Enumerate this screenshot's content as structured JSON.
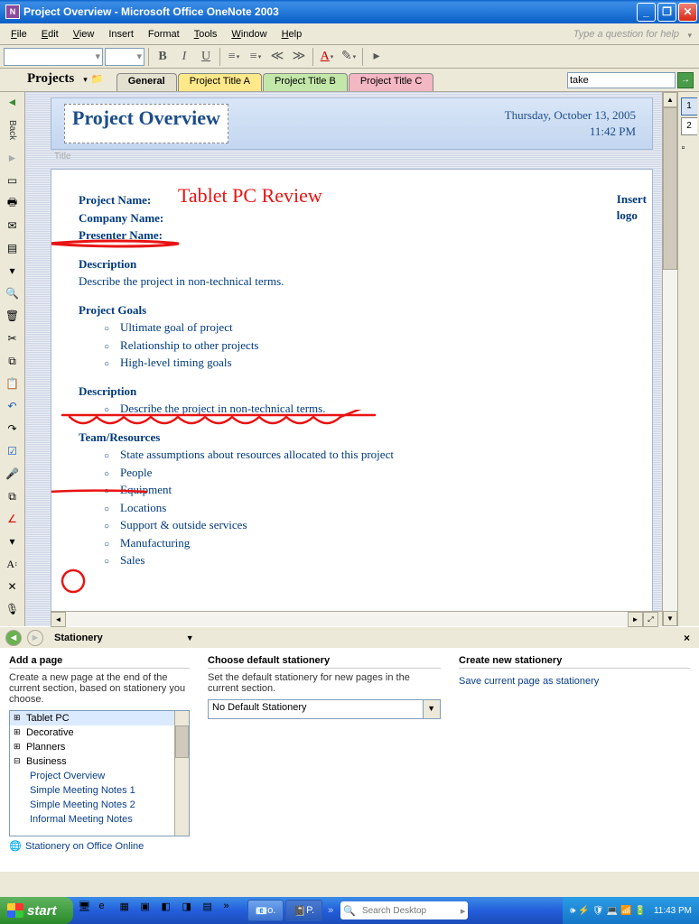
{
  "window": {
    "title": "Project Overview - Microsoft Office OneNote 2003"
  },
  "menu": {
    "file": "File",
    "edit": "Edit",
    "view": "View",
    "insert": "Insert",
    "format": "Format",
    "tools": "Tools",
    "window": "Window",
    "help": "Help",
    "help_placeholder": "Type a question for help"
  },
  "toolbar": {
    "bold": "B",
    "italic": "I",
    "underline": "U"
  },
  "sidebar_back": "Back",
  "section": {
    "name": "Projects"
  },
  "tabs": [
    {
      "label": "General",
      "style": "active"
    },
    {
      "label": "Project Title A",
      "style": "yellow"
    },
    {
      "label": "Project Title B",
      "style": "green"
    },
    {
      "label": "Project Title C",
      "style": "pink"
    }
  ],
  "search": {
    "value": "take"
  },
  "page": {
    "title": "Project Overview",
    "title_placeholder": "Title",
    "date": "Thursday, October 13, 2005",
    "time": "11:42 PM"
  },
  "page_tabs": {
    "p1": "1",
    "p2": "2"
  },
  "content": {
    "project_name_label": "Project Name:",
    "company_name_label": "Company Name:",
    "presenter_name_label": "Presenter Name:",
    "side1": "Insert",
    "side2": "logo",
    "desc_head": "Description",
    "desc_text": "Describe the project in non-technical terms.",
    "goals_head": "Project Goals",
    "goals": [
      "Ultimate goal of project",
      "Relationship to other projects",
      "High-level timing goals"
    ],
    "desc2_head": "Description",
    "desc2_bullet": "Describe the project in non-technical terms.",
    "team_head": "Team/Resources",
    "team": [
      "State assumptions about resources allocated to this project",
      "People",
      "Equipment",
      "Locations",
      "Support & outside services",
      "Manufacturing",
      "Sales"
    ],
    "ink_text": "Tablet PC Review"
  },
  "taskpane": {
    "title": "Stationery",
    "col1_head": "Add a page",
    "col1_desc": "Create a new page at the end of the current section, based on stationery you choose.",
    "categories": {
      "tablet": "Tablet PC",
      "decorative": "Decorative",
      "planners": "Planners",
      "business": "Business"
    },
    "business_items": [
      "Project Overview",
      "Simple Meeting Notes 1",
      "Simple Meeting Notes 2",
      "Informal Meeting Notes"
    ],
    "online_link": "Stationery on Office Online",
    "col2_head": "Choose default stationery",
    "col2_desc": "Set the default stationery for new pages in the current section.",
    "default_sel": "No Default Stationery",
    "col3_head": "Create new stationery",
    "save_link": "Save current page as stationery"
  },
  "taskbar": {
    "start": "start",
    "tasks": {
      "o": "o.",
      "p": "P."
    },
    "search_placeholder": "Search Desktop",
    "clock": "11:43 PM"
  }
}
